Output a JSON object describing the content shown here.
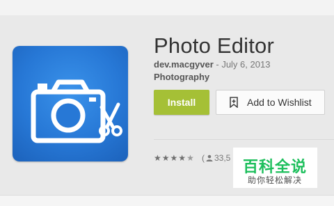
{
  "app": {
    "title": "Photo Editor",
    "developer": "dev.macgyver",
    "separator_date": " - July 6, 2013",
    "category": "Photography"
  },
  "actions": {
    "install_label": "Install",
    "wishlist_label": "Add to Wishlist"
  },
  "rating": {
    "stars_filled": 4.5,
    "stars_total": 5,
    "count_prefix": "(",
    "count_text": "33,5"
  },
  "icons": {
    "app_icon": "camera-scissors-icon",
    "wishlist_icon": "bookmark-plus-icon",
    "person_icon": "person-icon",
    "star_icon": "star-icon"
  },
  "colors": {
    "install": "#a5c036",
    "icon_blue": "#2778d6",
    "watermark_green": "#1dbf5c"
  },
  "watermark": {
    "main": "百科全说",
    "sub": "助你轻松解决"
  }
}
